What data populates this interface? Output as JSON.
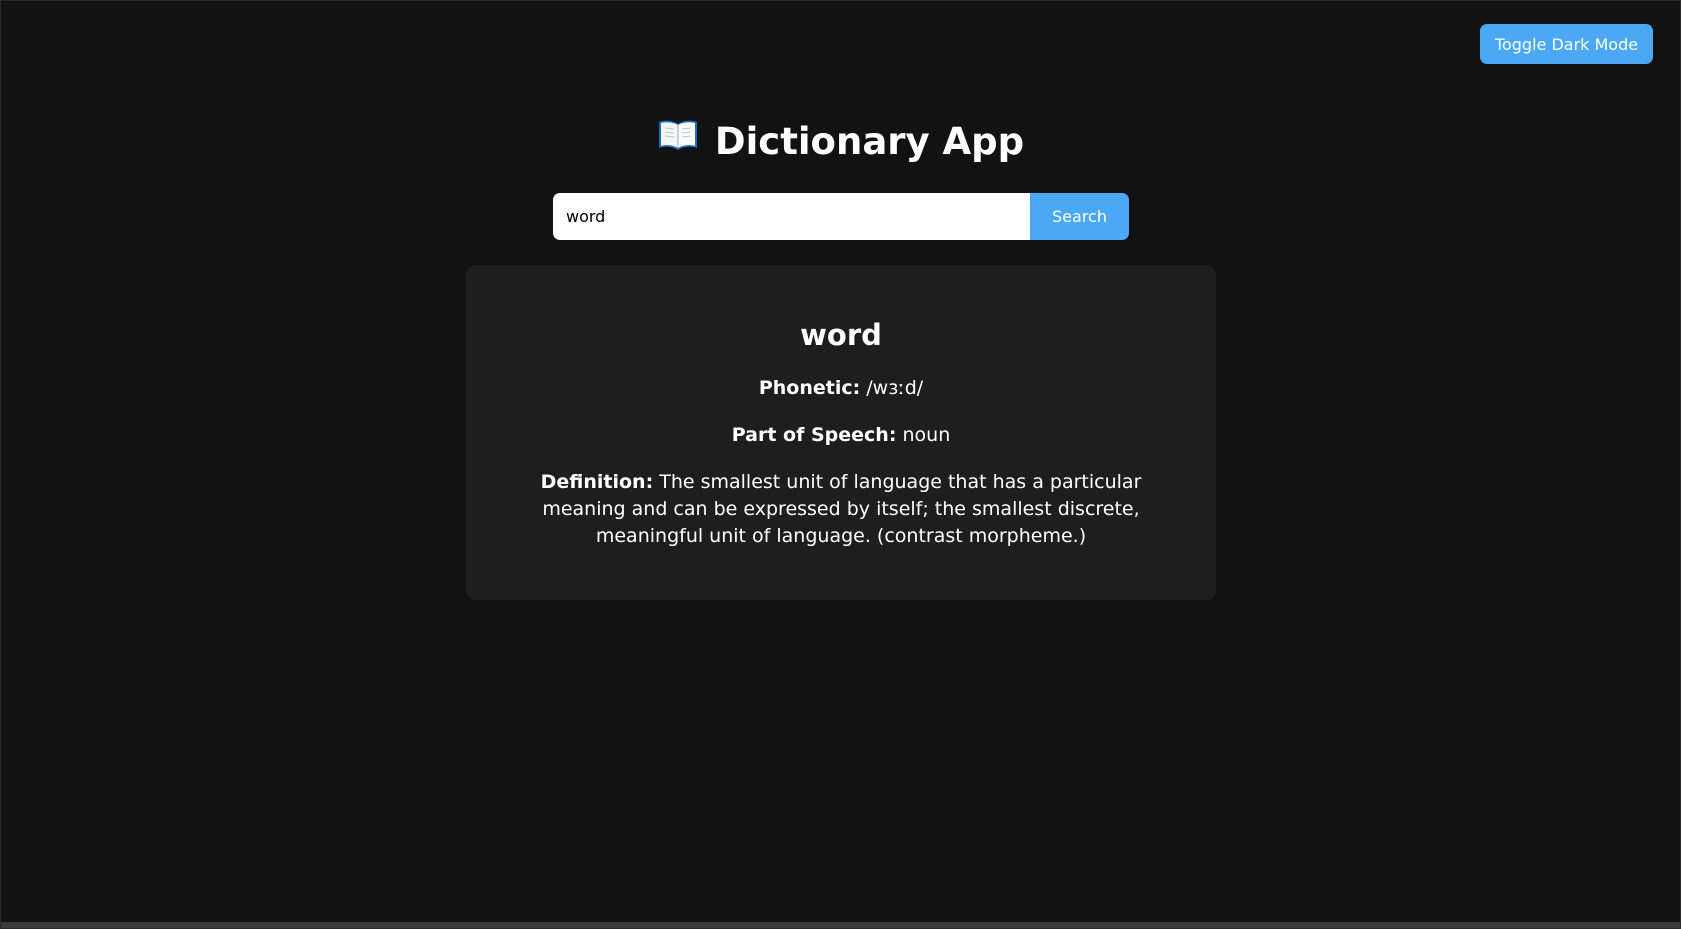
{
  "header": {
    "toggle_label": "Toggle Dark Mode",
    "title": "Dictionary App",
    "title_icon": "open-book-icon"
  },
  "search": {
    "value": "word",
    "button_label": "Search"
  },
  "result": {
    "word": "word",
    "phonetic_label": "Phonetic:",
    "phonetic": "/wɜːd/",
    "pos_label": "Part of Speech:",
    "pos": "noun",
    "definition_label": "Definition:",
    "definition": "The smallest unit of language that has a particular meaning and can be expressed by itself; the smallest discrete, meaningful unit of language. (contrast morpheme.)"
  },
  "colors": {
    "background": "#121212",
    "card": "#1e1e1e",
    "accent": "#4aa8f5",
    "text": "#ffffff"
  }
}
